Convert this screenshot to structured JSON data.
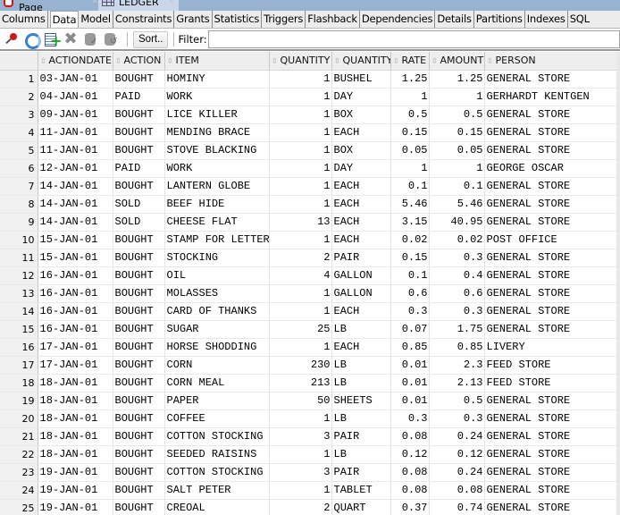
{
  "document_tabs": [
    {
      "label": "Welcome Page",
      "icon": "oracle-icon",
      "active": false
    },
    {
      "label": "LEDGER",
      "icon": "table-grid-icon",
      "active": true
    }
  ],
  "sub_tabs": [
    "Columns",
    "Data",
    "Model",
    "Constraints",
    "Grants",
    "Statistics",
    "Triggers",
    "Flashback",
    "Dependencies",
    "Details",
    "Partitions",
    "Indexes",
    "SQL"
  ],
  "active_sub_tab": "Data",
  "toolbar": {
    "icons": [
      "pin-icon",
      "refresh-icon",
      "insert-row-icon",
      "delete-icon",
      "commit-icon",
      "rollback-icon"
    ],
    "sort_label": "Sort..",
    "filter_label": "Filter:",
    "filter_value": ""
  },
  "grid": {
    "columns": [
      "ACTIONDATE",
      "ACTION",
      "ITEM",
      "QUANTITY",
      "QUANTITYTYPE",
      "RATE",
      "AMOUNT",
      "PERSON"
    ],
    "rows": [
      [
        "1",
        "03-JAN-01",
        "BOUGHT",
        "HOMINY",
        "1",
        "BUSHEL",
        "1.25",
        "1.25",
        "GENERAL STORE"
      ],
      [
        "2",
        "04-JAN-01",
        "PAID",
        "WORK",
        "1",
        "DAY",
        "1",
        "1",
        "GERHARDT KENTGEN"
      ],
      [
        "3",
        "09-JAN-01",
        "BOUGHT",
        "LICE KILLER",
        "1",
        "BOX",
        "0.5",
        "0.5",
        "GENERAL STORE"
      ],
      [
        "4",
        "11-JAN-01",
        "BOUGHT",
        "MENDING BRACE",
        "1",
        "EACH",
        "0.15",
        "0.15",
        "GENERAL STORE"
      ],
      [
        "5",
        "11-JAN-01",
        "BOUGHT",
        "STOVE BLACKING",
        "1",
        "BOX",
        "0.05",
        "0.05",
        "GENERAL STORE"
      ],
      [
        "6",
        "12-JAN-01",
        "PAID",
        "WORK",
        "1",
        "DAY",
        "1",
        "1",
        "GEORGE OSCAR"
      ],
      [
        "7",
        "14-JAN-01",
        "BOUGHT",
        "LANTERN GLOBE",
        "1",
        "EACH",
        "0.1",
        "0.1",
        "GENERAL STORE"
      ],
      [
        "8",
        "14-JAN-01",
        "SOLD",
        "BEEF HIDE",
        "1",
        "EACH",
        "5.46",
        "5.46",
        "GENERAL STORE"
      ],
      [
        "9",
        "14-JAN-01",
        "SOLD",
        "CHEESE FLAT",
        "13",
        "EACH",
        "3.15",
        "40.95",
        "GENERAL STORE"
      ],
      [
        "10",
        "15-JAN-01",
        "BOUGHT",
        "STAMP FOR LETTER",
        "1",
        "EACH",
        "0.02",
        "0.02",
        "POST OFFICE"
      ],
      [
        "11",
        "15-JAN-01",
        "BOUGHT",
        "STOCKING",
        "2",
        "PAIR",
        "0.15",
        "0.3",
        "GENERAL STORE"
      ],
      [
        "12",
        "16-JAN-01",
        "BOUGHT",
        "OIL",
        "4",
        "GALLON",
        "0.1",
        "0.4",
        "GENERAL STORE"
      ],
      [
        "13",
        "16-JAN-01",
        "BOUGHT",
        "MOLASSES",
        "1",
        "GALLON",
        "0.6",
        "0.6",
        "GENERAL STORE"
      ],
      [
        "14",
        "16-JAN-01",
        "BOUGHT",
        "CARD OF THANKS",
        "1",
        "EACH",
        "0.3",
        "0.3",
        "GENERAL STORE"
      ],
      [
        "15",
        "16-JAN-01",
        "BOUGHT",
        "SUGAR",
        "25",
        "LB",
        "0.07",
        "1.75",
        "GENERAL STORE"
      ],
      [
        "16",
        "17-JAN-01",
        "BOUGHT",
        "HORSE SHODDING",
        "1",
        "EACH",
        "0.85",
        "0.85",
        "LIVERY"
      ],
      [
        "17",
        "17-JAN-01",
        "BOUGHT",
        "CORN",
        "230",
        "LB",
        "0.01",
        "2.3",
        "FEED STORE"
      ],
      [
        "18",
        "18-JAN-01",
        "BOUGHT",
        "CORN MEAL",
        "213",
        "LB",
        "0.01",
        "2.13",
        "FEED STORE"
      ],
      [
        "19",
        "18-JAN-01",
        "BOUGHT",
        "PAPER",
        "50",
        "SHEETS",
        "0.01",
        "0.5",
        "GENERAL STORE"
      ],
      [
        "20",
        "18-JAN-01",
        "BOUGHT",
        "COFFEE",
        "1",
        "LB",
        "0.3",
        "0.3",
        "GENERAL STORE"
      ],
      [
        "21",
        "18-JAN-01",
        "BOUGHT",
        "COTTON STOCKING",
        "3",
        "PAIR",
        "0.08",
        "0.24",
        "GENERAL STORE"
      ],
      [
        "22",
        "18-JAN-01",
        "BOUGHT",
        "SEEDED RAISINS",
        "1",
        "LB",
        "0.12",
        "0.12",
        "GENERAL STORE"
      ],
      [
        "23",
        "19-JAN-01",
        "BOUGHT",
        "COTTON STOCKING",
        "3",
        "PAIR",
        "0.08",
        "0.24",
        "GENERAL STORE"
      ],
      [
        "24",
        "19-JAN-01",
        "BOUGHT",
        "SALT PETER",
        "1",
        "TABLET",
        "0.08",
        "0.08",
        "GENERAL STORE"
      ],
      [
        "25",
        "19-JAN-01",
        "BOUGHT",
        "CREOAL",
        "2",
        "QUART",
        "0.37",
        "0.74",
        "GENERAL STORE"
      ]
    ]
  }
}
